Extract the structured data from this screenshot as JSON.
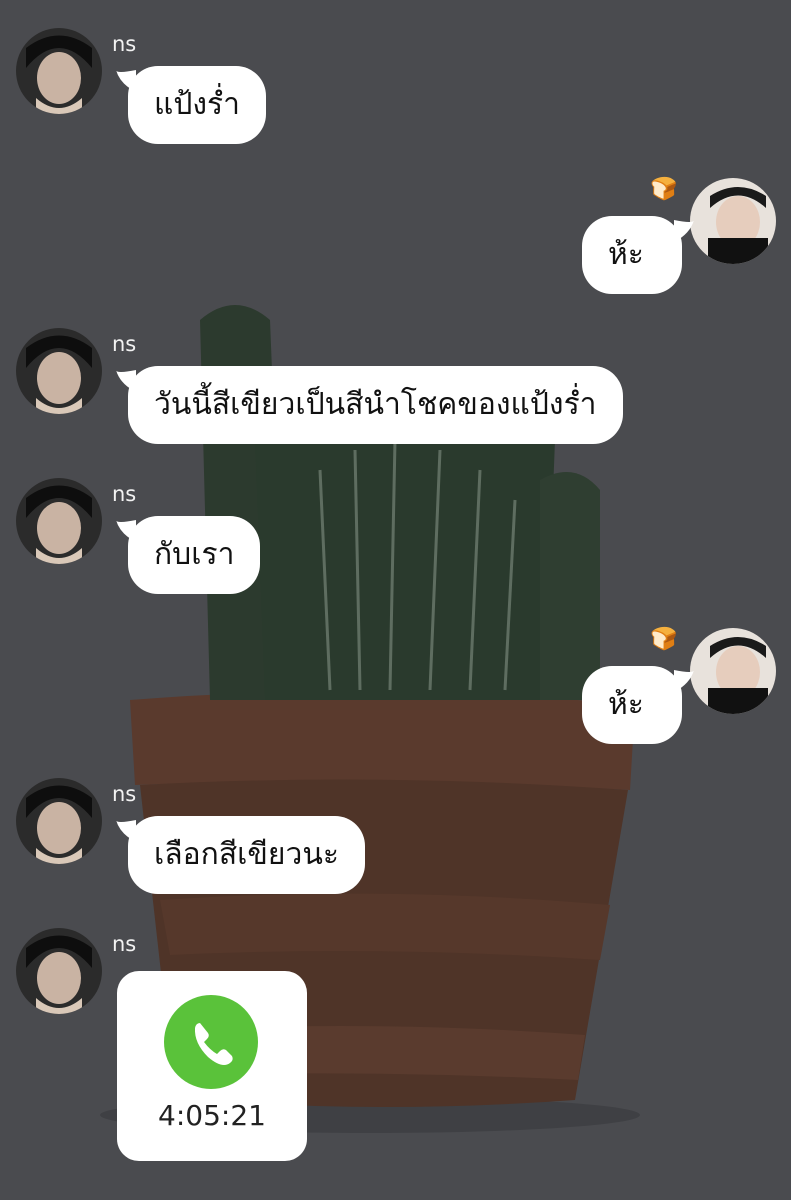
{
  "contact": {
    "name": "ns"
  },
  "messages": [
    {
      "sender": "ns",
      "text": "แป้งร่ำ"
    },
    {
      "sender": "me",
      "text": "ห้ะ",
      "reaction_emoji": "🍞"
    },
    {
      "sender": "ns",
      "text": "วันนี้สีเขียวเป็นสีนำโชคของแป้งร่ำ"
    },
    {
      "sender": "ns",
      "text": "กับเรา"
    },
    {
      "sender": "me",
      "text": "ห้ะ",
      "reaction_emoji": "🍞"
    },
    {
      "sender": "ns",
      "text": "เลือกสีเขียวนะ"
    },
    {
      "sender": "ns",
      "type": "call",
      "duration": "4:05:21",
      "icon": "phone-icon"
    }
  ],
  "colors": {
    "background": "#4a4b4f",
    "bubble": "#ffffff",
    "call_green": "#5ac23a"
  }
}
